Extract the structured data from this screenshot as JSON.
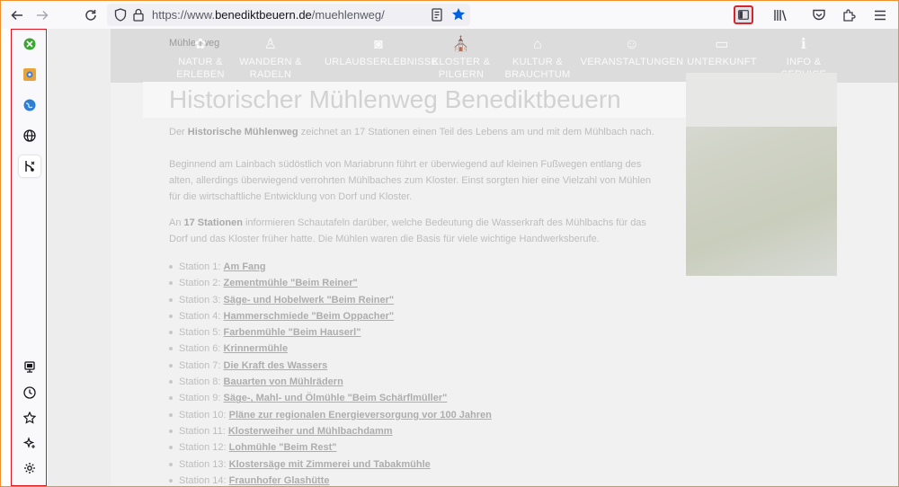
{
  "browser": {
    "url_prefix": "https://www.",
    "url_domain": "benediktbeuern.de",
    "url_path": "/muehlenweg/"
  },
  "site": {
    "breadcrumb": "Mühlenweg",
    "nav": [
      {
        "label": "NATUR & ERLEBEN",
        "icon": "flower-icon"
      },
      {
        "label": "WANDERN & RADELN",
        "icon": "hiker-icon"
      },
      {
        "label": "URLAUBSERLEBNISSE",
        "icon": "camera-icon"
      },
      {
        "label": "KLOSTER & PILGERN",
        "icon": "monastery-icon"
      },
      {
        "label": "KULTUR & BRAUCHTUM",
        "icon": "museum-icon"
      },
      {
        "label": "VERANSTALTUNGEN",
        "icon": "mask-icon"
      },
      {
        "label": "UNTERKUNFT",
        "icon": "bed-icon"
      },
      {
        "label": "INFO & SERVICE",
        "icon": "info-icon"
      }
    ],
    "title": "Historischer Mühlenweg Benediktbeuern",
    "intro_pre": "Der ",
    "intro_bold": "Historische Mühlenweg",
    "intro_post": " zeichnet an 17 Stationen einen Teil des Lebens am und mit dem Mühlbach nach.",
    "para2": "Beginnend am Lainbach südöstlich von Mariabrunn führt er überwiegend auf kleinen Fußwegen entlang des alten, allerdings überwiegend verrohrten Mühlbaches zum Kloster. Einst sorgten hier eine Vielzahl von Mühlen für die wirtschaftliche Entwicklung von Dorf und Kloster.",
    "para3_pre": "An ",
    "para3_bold": "17 Stationen",
    "para3_post": " informieren Schautafeln darüber, welche Bedeutung die Wasserkraft des Mühlbachs für das Dorf und das Kloster früher hatte. Die Mühlen waren die Basis für viele wichtige Handwerksberufe.",
    "stations": [
      {
        "prefix": "Station 1:",
        "name": "Am Fang"
      },
      {
        "prefix": "Station 2:",
        "name": "Zementmühle \"Beim Reiner\""
      },
      {
        "prefix": "Station 3:",
        "name": "Säge- und Hobelwerk \"Beim Reiner\""
      },
      {
        "prefix": "Station 4:",
        "name": "Hammerschmiede \"Beim Oppacher\""
      },
      {
        "prefix": "Station 5:",
        "name": "Farbenmühle \"Beim Hauserl\""
      },
      {
        "prefix": "Station 6:",
        "name": "Krinnermühle"
      },
      {
        "prefix": "Station 7:",
        "name": "Die Kraft des Wassers"
      },
      {
        "prefix": "Station 8:",
        "name": "Bauarten von Mühlrädern"
      },
      {
        "prefix": "Station 9:",
        "name": "Säge-, Mahl- und Ölmühle \"Beim Schärflmüller\""
      },
      {
        "prefix": "Station 10:",
        "name": "Pläne zur regionalen Energieversorgung vor 100 Jahren"
      },
      {
        "prefix": "Station 11:",
        "name": "Klosterweiher und Mühlbachdamm"
      },
      {
        "prefix": "Station 12:",
        "name": "Lohmühle \"Beim Rest\""
      },
      {
        "prefix": "Station 13:",
        "name": "Klostersäge mit Zimmerei und Tabakmühle"
      },
      {
        "prefix": "Station 14:",
        "name": "Fraunhofer Glashütte"
      }
    ]
  },
  "colors": {
    "frame_border": "#f0902c",
    "highlight_border": "#e0141e",
    "bookmark_star": "#0060df"
  }
}
